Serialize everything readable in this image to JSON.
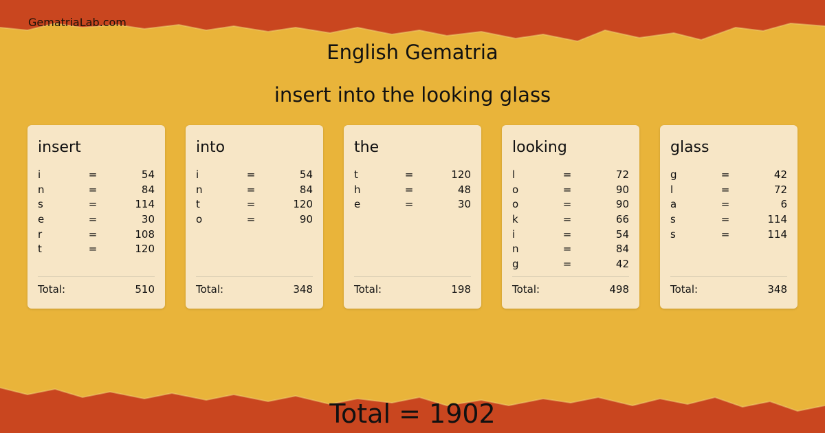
{
  "site": "GematriaLab.com",
  "title": "English Gematria",
  "phrase": "insert into the looking glass",
  "colors": {
    "background": "#e9b43a",
    "band": "#c9461f",
    "card": "#f7e6c6"
  },
  "words": [
    {
      "word": "insert",
      "total_label": "Total:",
      "total": "510",
      "letters": [
        {
          "ch": "i",
          "eq": "=",
          "val": "54"
        },
        {
          "ch": "n",
          "eq": "=",
          "val": "84"
        },
        {
          "ch": "s",
          "eq": "=",
          "val": "114"
        },
        {
          "ch": "e",
          "eq": "=",
          "val": "30"
        },
        {
          "ch": "r",
          "eq": "=",
          "val": "108"
        },
        {
          "ch": "t",
          "eq": "=",
          "val": "120"
        }
      ]
    },
    {
      "word": "into",
      "total_label": "Total:",
      "total": "348",
      "letters": [
        {
          "ch": "i",
          "eq": "=",
          "val": "54"
        },
        {
          "ch": "n",
          "eq": "=",
          "val": "84"
        },
        {
          "ch": "t",
          "eq": "=",
          "val": "120"
        },
        {
          "ch": "o",
          "eq": "=",
          "val": "90"
        }
      ]
    },
    {
      "word": "the",
      "total_label": "Total:",
      "total": "198",
      "letters": [
        {
          "ch": "t",
          "eq": "=",
          "val": "120"
        },
        {
          "ch": "h",
          "eq": "=",
          "val": "48"
        },
        {
          "ch": "e",
          "eq": "=",
          "val": "30"
        }
      ]
    },
    {
      "word": "looking",
      "total_label": "Total:",
      "total": "498",
      "letters": [
        {
          "ch": "l",
          "eq": "=",
          "val": "72"
        },
        {
          "ch": "o",
          "eq": "=",
          "val": "90"
        },
        {
          "ch": "o",
          "eq": "=",
          "val": "90"
        },
        {
          "ch": "k",
          "eq": "=",
          "val": "66"
        },
        {
          "ch": "i",
          "eq": "=",
          "val": "54"
        },
        {
          "ch": "n",
          "eq": "=",
          "val": "84"
        },
        {
          "ch": "g",
          "eq": "=",
          "val": "42"
        }
      ]
    },
    {
      "word": "glass",
      "total_label": "Total:",
      "total": "348",
      "letters": [
        {
          "ch": "g",
          "eq": "=",
          "val": "42"
        },
        {
          "ch": "l",
          "eq": "=",
          "val": "72"
        },
        {
          "ch": "a",
          "eq": "=",
          "val": "6"
        },
        {
          "ch": "s",
          "eq": "=",
          "val": "114"
        },
        {
          "ch": "s",
          "eq": "=",
          "val": "114"
        }
      ]
    }
  ],
  "grand_total": "Total = 1902"
}
